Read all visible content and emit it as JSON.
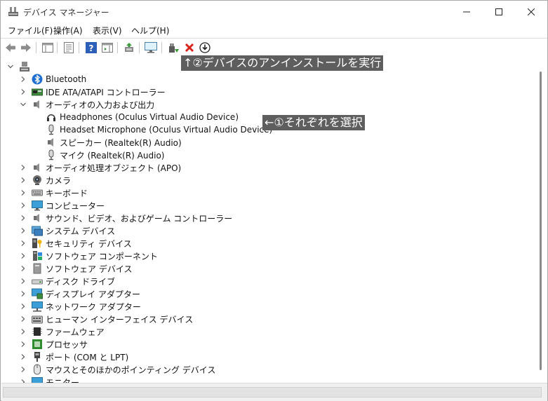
{
  "window": {
    "title": "デバイス マネージャー"
  },
  "menu": [
    {
      "label": "ファイル(F)"
    },
    {
      "label": "操作(A)"
    },
    {
      "label": "表示(V)"
    },
    {
      "label": "ヘルプ(H)"
    }
  ],
  "toolbar_icons": [
    "back-arrow-icon",
    "forward-arrow-icon",
    "console-tree-icon",
    "properties-icon",
    "help-icon",
    "action-pane-icon",
    "update-driver-icon",
    "scan-hardware-icon",
    "enable-device-icon",
    "uninstall-device-icon",
    "download-icon"
  ],
  "tree": {
    "root_expanded": true,
    "categories": [
      {
        "label": "Bluetooth",
        "icon": "bluetooth-icon",
        "expanded": false
      },
      {
        "label": "IDE ATA/ATAPI コントローラー",
        "icon": "ide-controller-icon",
        "expanded": false
      },
      {
        "label": "オーディオの入力および出力",
        "icon": "speaker-icon",
        "expanded": true,
        "children": [
          {
            "label": "Headphones (Oculus Virtual Audio Device)",
            "icon": "headphones-icon"
          },
          {
            "label": "Headset Microphone (Oculus Virtual Audio Device)",
            "icon": "microphone-icon"
          },
          {
            "label": "スピーカー (Realtek(R) Audio)",
            "icon": "speaker-icon"
          },
          {
            "label": "マイク (Realtek(R) Audio)",
            "icon": "microphone-icon"
          }
        ]
      },
      {
        "label": "オーディオ処理オブジェクト (APO)",
        "icon": "speaker-icon",
        "expanded": false
      },
      {
        "label": "カメラ",
        "icon": "camera-icon",
        "expanded": false
      },
      {
        "label": "キーボード",
        "icon": "keyboard-icon",
        "expanded": false
      },
      {
        "label": "コンピューター",
        "icon": "monitor-icon",
        "expanded": false
      },
      {
        "label": "サウンド、ビデオ、およびゲーム コントローラー",
        "icon": "speaker-icon",
        "expanded": false
      },
      {
        "label": "システム デバイス",
        "icon": "system-device-icon",
        "expanded": false
      },
      {
        "label": "セキュリティ デバイス",
        "icon": "security-key-icon",
        "expanded": false
      },
      {
        "label": "ソフトウェア コンポーネント",
        "icon": "software-component-icon",
        "expanded": false
      },
      {
        "label": "ソフトウェア デバイス",
        "icon": "software-device-icon",
        "expanded": false
      },
      {
        "label": "ディスク ドライブ",
        "icon": "disk-drive-icon",
        "expanded": false
      },
      {
        "label": "ディスプレイ アダプター",
        "icon": "display-adapter-icon",
        "expanded": false
      },
      {
        "label": "ネットワーク アダプター",
        "icon": "network-adapter-icon",
        "expanded": false
      },
      {
        "label": "ヒューマン インターフェイス デバイス",
        "icon": "hid-icon",
        "expanded": false
      },
      {
        "label": "ファームウェア",
        "icon": "firmware-icon",
        "expanded": false
      },
      {
        "label": "プロセッサ",
        "icon": "processor-icon",
        "expanded": false
      },
      {
        "label": "ポート (COM と LPT)",
        "icon": "port-icon",
        "expanded": false
      },
      {
        "label": "マウスとそのほかのポインティング デバイス",
        "icon": "mouse-icon",
        "expanded": false
      },
      {
        "label": "モニター",
        "icon": "monitor-icon",
        "expanded": false
      }
    ]
  },
  "annotations": {
    "toolbar_note": "↑②デバイスのアンインストールを実行",
    "select_note": "←①それぞれを選択"
  },
  "colors": {
    "annotation_bg": "#5e5e5e",
    "annotation_text": "#ffffff",
    "uninstall_red": "#d9261c",
    "help_blue": "#2c5fb8"
  }
}
